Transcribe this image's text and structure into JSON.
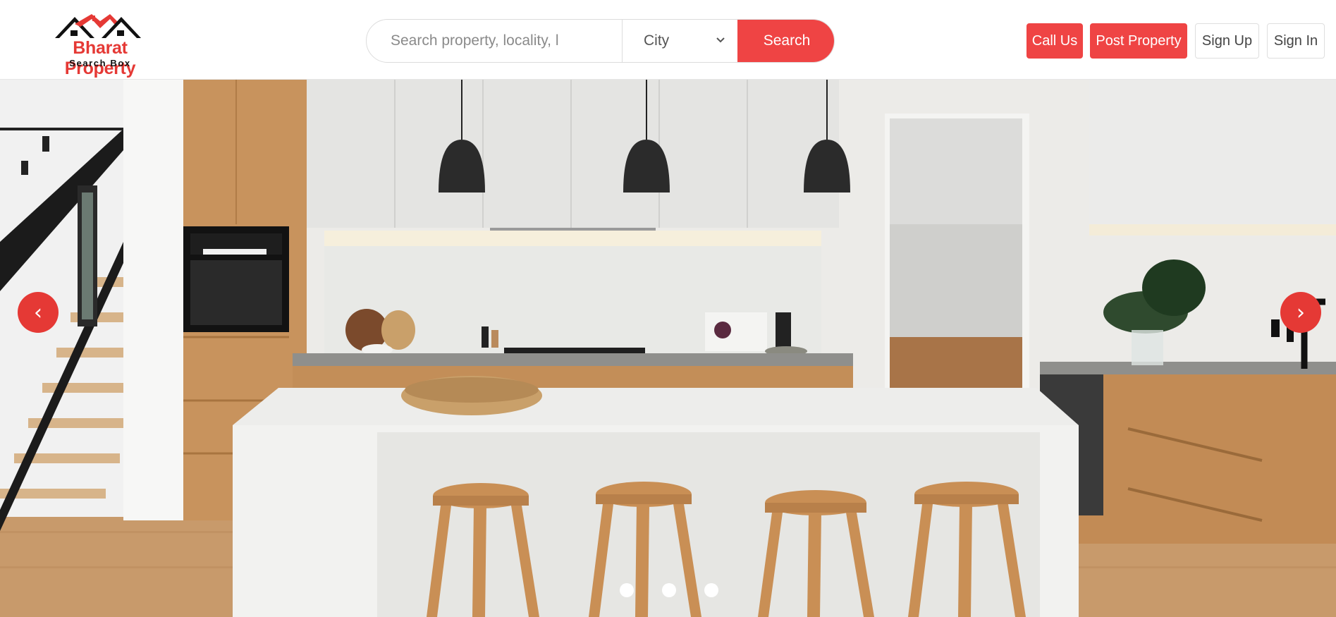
{
  "brand": {
    "name": "Bharat Property",
    "tagline": "Search Box",
    "accent_color": "#ef4444"
  },
  "search": {
    "placeholder": "Search property, locality, l",
    "city_selected": "City",
    "button_label": "Search"
  },
  "nav": {
    "call_us": "Call Us",
    "post_property": "Post Property",
    "sign_up": "Sign Up",
    "sign_in": "Sign In"
  },
  "carousel": {
    "prev_icon": "‹",
    "next_icon": "›",
    "slide_count": 3,
    "active_slide": 1
  }
}
